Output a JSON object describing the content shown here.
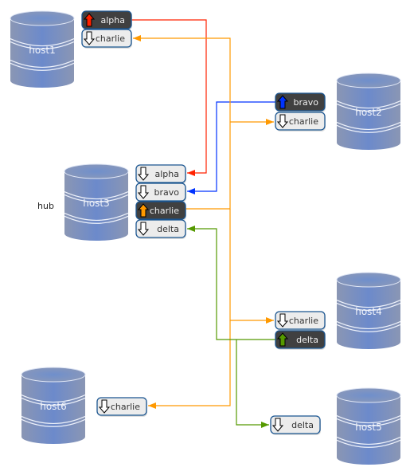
{
  "hub_label": "hub",
  "colors": {
    "alpha": "#ff2200",
    "bravo": "#0033ff",
    "charlie": "#ff9900",
    "delta": "#559900",
    "outline": "#1a5590",
    "dark_badge": "#404040",
    "light_badge": "#ececec"
  },
  "hosts": [
    {
      "id": "host1",
      "label": "host1"
    },
    {
      "id": "host2",
      "label": "host2"
    },
    {
      "id": "host3",
      "label": "host3"
    },
    {
      "id": "host4",
      "label": "host4"
    },
    {
      "id": "host5",
      "label": "host5"
    },
    {
      "id": "host6",
      "label": "host6"
    }
  ],
  "ports": [
    {
      "host": "host1",
      "label": "alpha",
      "direction": "out",
      "topic": "alpha"
    },
    {
      "host": "host1",
      "label": "charlie",
      "direction": "in",
      "topic": "charlie"
    },
    {
      "host": "host2",
      "label": "bravo",
      "direction": "out",
      "topic": "bravo"
    },
    {
      "host": "host2",
      "label": "charlie",
      "direction": "in",
      "topic": "charlie"
    },
    {
      "host": "host3",
      "label": "alpha",
      "direction": "in",
      "topic": "alpha"
    },
    {
      "host": "host3",
      "label": "bravo",
      "direction": "in",
      "topic": "bravo"
    },
    {
      "host": "host3",
      "label": "charlie",
      "direction": "out",
      "topic": "charlie"
    },
    {
      "host": "host3",
      "label": "delta",
      "direction": "in",
      "topic": "delta"
    },
    {
      "host": "host4",
      "label": "charlie",
      "direction": "in",
      "topic": "charlie"
    },
    {
      "host": "host4",
      "label": "delta",
      "direction": "out",
      "topic": "delta"
    },
    {
      "host": "host6",
      "label": "charlie",
      "direction": "in",
      "topic": "charlie"
    },
    {
      "host": "host5",
      "label": "delta",
      "direction": "in",
      "topic": "delta"
    }
  ],
  "connections": [
    {
      "from": "host1.alpha",
      "to": "host3.alpha",
      "topic": "alpha"
    },
    {
      "from": "host2.bravo",
      "to": "host3.bravo",
      "topic": "bravo"
    },
    {
      "from": "host3.charlie",
      "to": "host1.charlie",
      "topic": "charlie"
    },
    {
      "from": "host3.charlie",
      "to": "host2.charlie",
      "topic": "charlie"
    },
    {
      "from": "host3.charlie",
      "to": "host4.charlie",
      "topic": "charlie"
    },
    {
      "from": "host3.charlie",
      "to": "host6.charlie",
      "topic": "charlie"
    },
    {
      "from": "host4.delta",
      "to": "host3.delta",
      "topic": "delta"
    },
    {
      "from": "host4.delta",
      "to": "host5.delta",
      "topic": "delta"
    }
  ]
}
